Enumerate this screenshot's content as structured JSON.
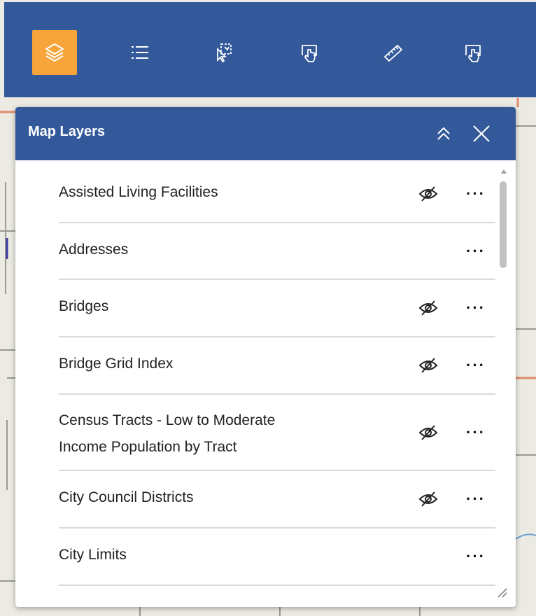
{
  "toolbar": {
    "tools": [
      {
        "icon": "layers-icon",
        "active": true
      },
      {
        "icon": "list-icon",
        "active": false
      },
      {
        "icon": "select-icon",
        "active": false
      },
      {
        "icon": "identify-icon",
        "active": false
      },
      {
        "icon": "measure-icon",
        "active": false
      },
      {
        "icon": "identify-icon",
        "active": false
      }
    ],
    "accent_color": "#f7a53b",
    "bar_color": "#33599a"
  },
  "panel": {
    "title": "Map Layers",
    "collapse_icon": "double-chevron-up-icon",
    "close_icon": "close-icon",
    "layers": [
      {
        "label_lines": [
          "Assisted Living Facilities"
        ],
        "hidden": true
      },
      {
        "label_lines": [
          "Addresses"
        ],
        "hidden": false
      },
      {
        "label_lines": [
          "Bridges"
        ],
        "hidden": true
      },
      {
        "label_lines": [
          "Bridge Grid Index"
        ],
        "hidden": true
      },
      {
        "label_lines": [
          "Census Tracts - Low to Moderate",
          "Income Population by Tract"
        ],
        "hidden": true
      },
      {
        "label_lines": [
          "City Council Districts"
        ],
        "hidden": true
      },
      {
        "label_lines": [
          "City Limits"
        ],
        "hidden": false
      }
    ],
    "more_label": "···"
  }
}
